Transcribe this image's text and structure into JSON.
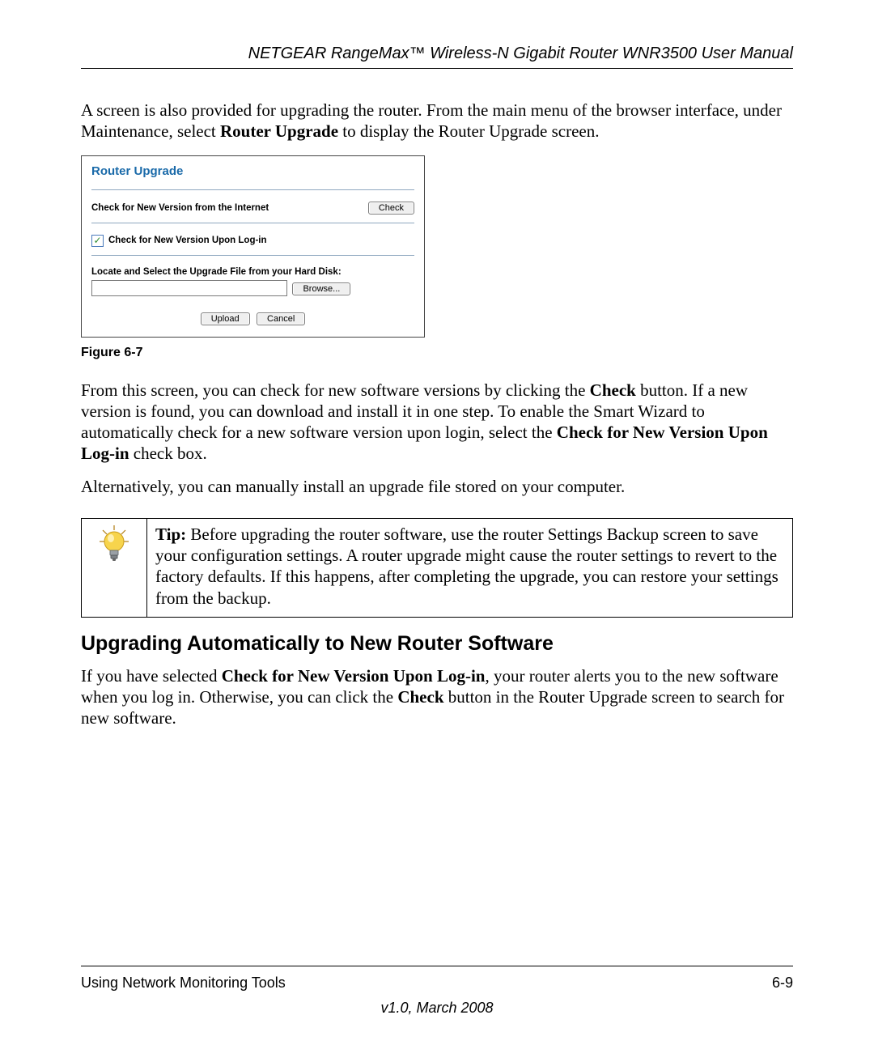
{
  "header": {
    "title": "NETGEAR RangeMax™ Wireless-N Gigabit Router WNR3500 User Manual"
  },
  "para1_a": "A screen is also provided for upgrading the router. From the main menu of the browser interface, under Maintenance, select ",
  "para1_bold": "Router Upgrade",
  "para1_b": " to display the Router Upgrade screen.",
  "panel": {
    "title": "Router Upgrade",
    "check_label": "Check for New Version from the Internet",
    "check_btn": "Check",
    "chk_label": "Check for New Version Upon Log-in",
    "locate_label": "Locate and Select the Upgrade File from your Hard Disk:",
    "browse_btn": "Browse...",
    "upload_btn": "Upload",
    "cancel_btn": "Cancel"
  },
  "figure_caption": "Figure 6-7",
  "para2_a": "From this screen, you can check for new software versions by clicking the ",
  "para2_bold1": "Check",
  "para2_b": " button. If a new version is found, you can download and install it in one step. To enable the Smart Wizard to automatically check for a new software version upon login, select the ",
  "para2_bold2": "Check for New Version Upon Log-in",
  "para2_c": " check box.",
  "para3": "Alternatively, you can manually install an upgrade file stored on your computer.",
  "tip": {
    "label": "Tip:",
    "text": " Before upgrading the router software, use the router Settings Backup screen to save your configuration settings. A router upgrade might cause the router settings to revert to the factory defaults. If this happens, after completing the upgrade, you can restore your settings from the backup."
  },
  "section_heading": "Upgrading Automatically to New Router Software",
  "para4_a": "If you have selected ",
  "para4_bold1": "Check for New Version Upon Log-in",
  "para4_b": ", your router alerts you to the new software when you log in. Otherwise, you can click the ",
  "para4_bold2": "Check",
  "para4_c": " button in the Router Upgrade screen to search for new software.",
  "footer": {
    "left": "Using Network Monitoring Tools",
    "right": "6-9",
    "version": "v1.0, March 2008"
  }
}
